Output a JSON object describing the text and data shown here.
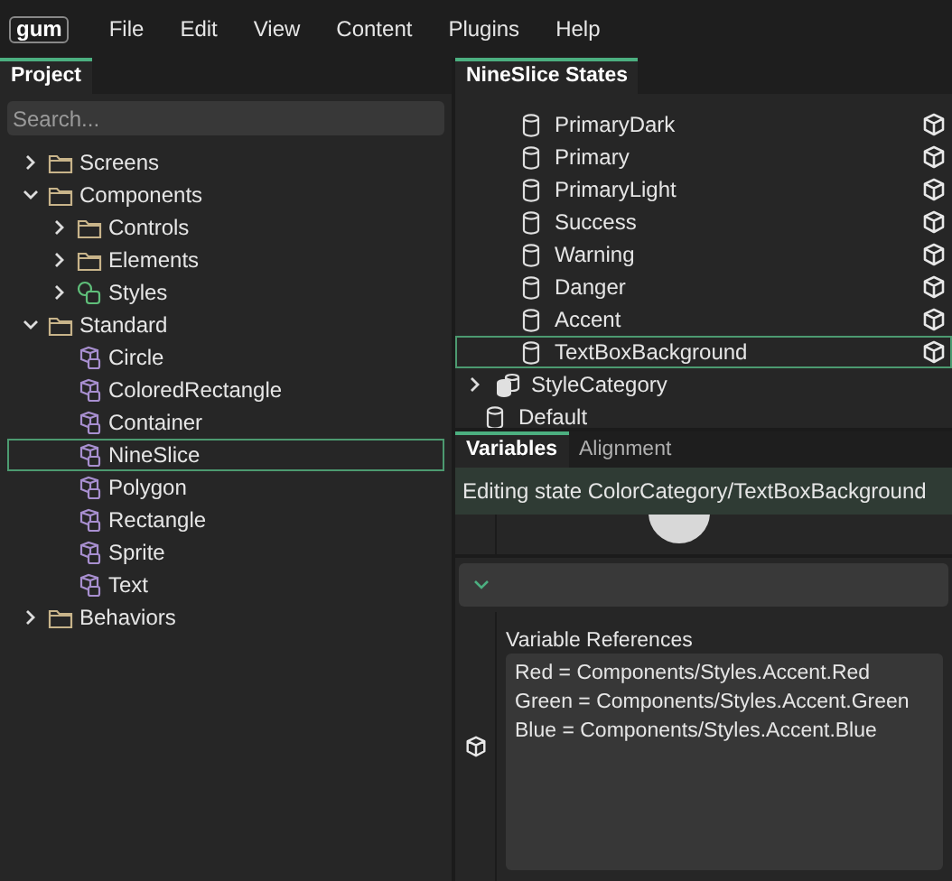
{
  "menu": {
    "logo": "gum",
    "items": [
      "File",
      "Edit",
      "View",
      "Content",
      "Plugins",
      "Help"
    ]
  },
  "project": {
    "tab": "Project",
    "search": {
      "placeholder": "Search..."
    },
    "tree": [
      {
        "label": "Screens",
        "kind": "folder",
        "expanded": false,
        "selected": false
      },
      {
        "label": "Components",
        "kind": "folder",
        "expanded": true,
        "selected": false,
        "children": [
          {
            "label": "Controls",
            "kind": "folder",
            "expanded": false,
            "selected": false
          },
          {
            "label": "Elements",
            "kind": "folder",
            "expanded": false,
            "selected": false
          },
          {
            "label": "Styles",
            "kind": "styles",
            "expanded": false,
            "selected": false
          }
        ]
      },
      {
        "label": "Standard",
        "kind": "folder",
        "expanded": true,
        "selected": false,
        "children": [
          {
            "label": "Circle",
            "kind": "standard",
            "selected": false
          },
          {
            "label": "ColoredRectangle",
            "kind": "standard",
            "selected": false
          },
          {
            "label": "Container",
            "kind": "standard",
            "selected": false
          },
          {
            "label": "NineSlice",
            "kind": "standard",
            "selected": true
          },
          {
            "label": "Polygon",
            "kind": "standard",
            "selected": false
          },
          {
            "label": "Rectangle",
            "kind": "standard",
            "selected": false
          },
          {
            "label": "Sprite",
            "kind": "standard",
            "selected": false
          },
          {
            "label": "Text",
            "kind": "standard",
            "selected": false
          }
        ]
      },
      {
        "label": "Behaviors",
        "kind": "folder",
        "expanded": false,
        "selected": false
      }
    ]
  },
  "states": {
    "tab": "NineSlice States",
    "items": [
      {
        "label": "PrimaryDark",
        "kind": "state",
        "selected": false
      },
      {
        "label": "Primary",
        "kind": "state",
        "selected": false
      },
      {
        "label": "PrimaryLight",
        "kind": "state",
        "selected": false
      },
      {
        "label": "Success",
        "kind": "state",
        "selected": false
      },
      {
        "label": "Warning",
        "kind": "state",
        "selected": false
      },
      {
        "label": "Danger",
        "kind": "state",
        "selected": false
      },
      {
        "label": "Accent",
        "kind": "state",
        "selected": false
      },
      {
        "label": "TextBoxBackground",
        "kind": "state",
        "selected": true
      },
      {
        "label": "StyleCategory",
        "kind": "category",
        "selected": false
      },
      {
        "label": "Default",
        "kind": "default",
        "selected": false
      }
    ]
  },
  "variables": {
    "tabs": [
      {
        "label": "Variables",
        "selected": true
      },
      {
        "label": "Alignment",
        "selected": false
      }
    ],
    "editing": "Editing state ColorCategory/TextBoxBackground",
    "references_label": "Variable References",
    "references": [
      "Red = Components/Styles.Accent.Red",
      "Green = Components/Styles.Accent.Green",
      "Blue = Components/Styles.Accent.Blue"
    ]
  }
}
